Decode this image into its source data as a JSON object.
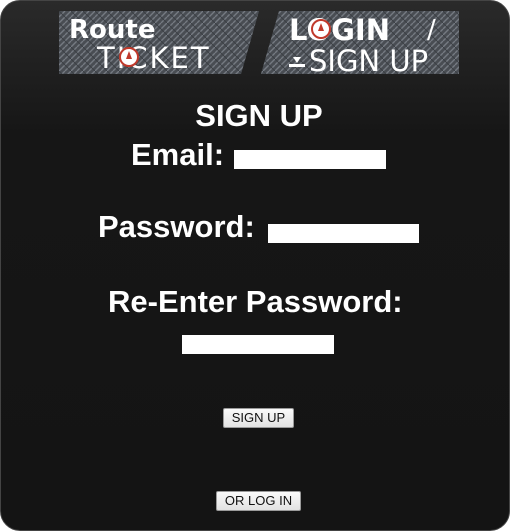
{
  "banner": {
    "route_text": "Route",
    "ticket_text": "TICKET",
    "login_text": "LOGIN",
    "slash_text": "/",
    "signup_text": "SIGN UP"
  },
  "form": {
    "title": "SIGN UP",
    "email_label": "Email:",
    "email_value": "",
    "password_label": "Password:",
    "password_value": "",
    "reenter_label": "Re-Enter Password:",
    "reenter_value": "",
    "submit_label": "SIGN UP",
    "login_link_label": "OR LOG IN"
  }
}
